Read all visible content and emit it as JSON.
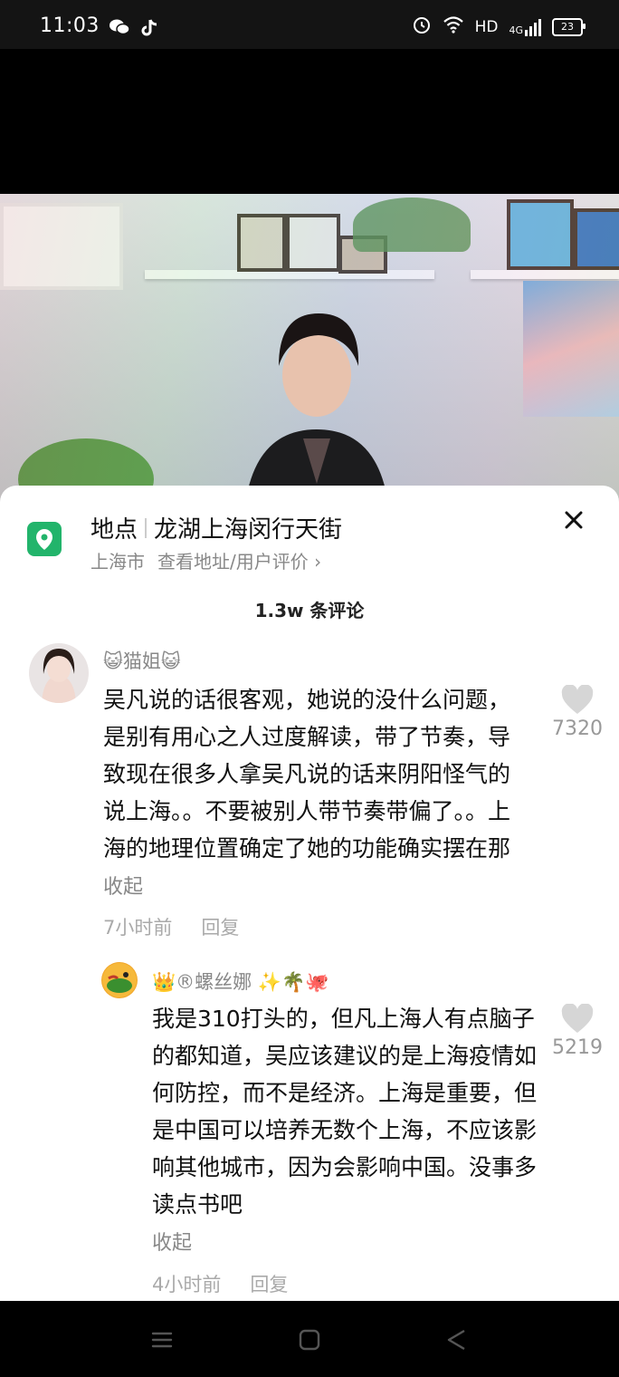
{
  "status_bar": {
    "time": "11:03",
    "apps": [
      "wechat-icon",
      "tiktok-icon"
    ],
    "indicators": [
      "alarm-icon",
      "wifi-icon"
    ],
    "hd_label": "HD",
    "network_label": "4G",
    "battery": "23"
  },
  "location": {
    "label": "地点",
    "name": "龙湖上海闵行天街",
    "city": "上海市",
    "details_link": "查看地址/用户评价 ›",
    "icon": "location-pin-icon"
  },
  "comments_header": {
    "count_text": "1.3w 条评论"
  },
  "comments": [
    {
      "username": "😺猫姐😺",
      "text": "吴凡说的话很客观，她说的没什么问题，是别有用心之人过度解读，带了节奏，导致现在很多人拿吴凡说的话来阴阳怪气的说上海。。不要被别人带节奏带偏了。。上海的地理位置确定了她的功能确实摆在那",
      "collapse_label": "收起",
      "time": "7小时前",
      "reply_label": "回复",
      "likes": "7320"
    },
    {
      "username": "👑®螺丝娜 ✨🌴🐙",
      "text": "我是310打头的，但凡上海人有点脑子的都知道，吴应该建议的是上海疫情如何防控，而不是经济。上海是重要，但是中国可以培养无数个上海，不应该影响其他城市，因为会影响中国。没事多读点书吧",
      "collapse_label": "收起",
      "time": "4小时前",
      "reply_label": "回复",
      "likes": "5219"
    }
  ],
  "colors": {
    "accent_green": "#22b46b",
    "like_gray": "#d6d6d6"
  }
}
